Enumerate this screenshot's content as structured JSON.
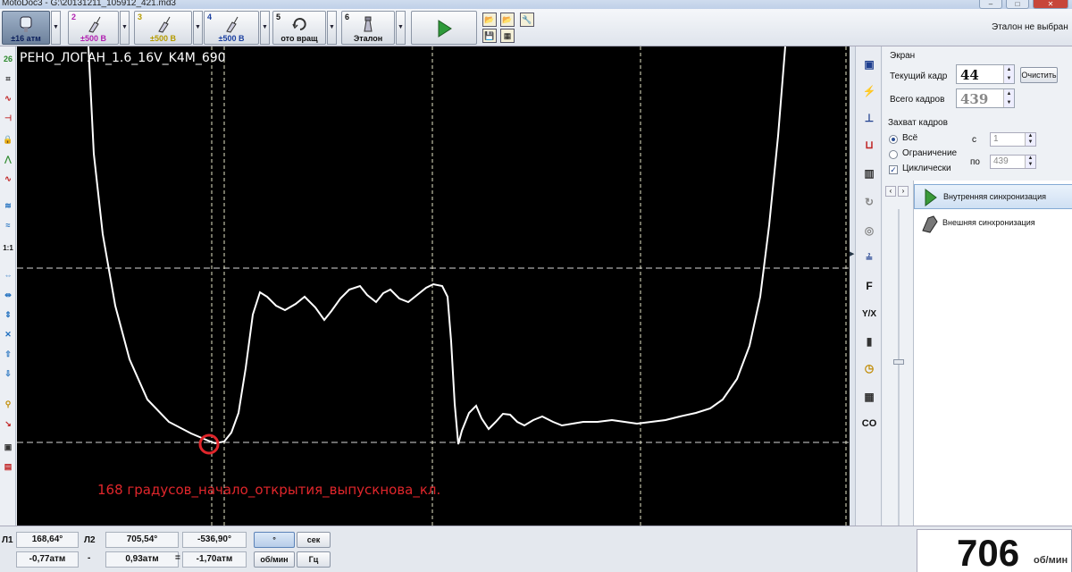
{
  "window": {
    "title": "MotoDoc3 - G:\\20131211_105912_421.md3",
    "close_label": "✕"
  },
  "toolbar": {
    "channels": [
      {
        "num": "",
        "label": "±16 атм",
        "color": "#1a3fa0"
      },
      {
        "num": "2",
        "label": "±500 В",
        "color": "#b020b0"
      },
      {
        "num": "3",
        "label": "±500 В",
        "color": "#b59b00"
      },
      {
        "num": "4",
        "label": "±500 В",
        "color": "#1a3fa0"
      },
      {
        "num": "5",
        "label": "ото вращ",
        "color": "#111111"
      },
      {
        "num": "6",
        "label": "Эталон",
        "color": "#111111"
      }
    ],
    "etalon_status": "Эталон не выбран"
  },
  "scope": {
    "title": "РЕНО_ЛОГАН_1.6_16V_K4M_690",
    "annotation": "168 градусов_начало_открытия_выпускнова_кл.",
    "trace_color": "#ffffff",
    "marker_color": "#e0262b"
  },
  "panel": {
    "screen_header": "Экран",
    "current_frame_label": "Текущий кадр",
    "current_frame_value": "44",
    "clear_button": "Очистить",
    "total_frames_label": "Всего кадров",
    "total_frames_value": "439",
    "capture_header": "Захват кадров",
    "opt_all": "Всё",
    "opt_limit": "Ограничение",
    "opt_cyclic": "Циклически",
    "from_label": "с",
    "from_value": "1",
    "to_label": "по",
    "to_value": "439",
    "sync_internal": "Внутренняя синхронизация",
    "sync_external": "Внешняя синхронизация"
  },
  "righttools": [
    "▣",
    "⚡",
    "⊥",
    "⊔",
    "▥",
    "↻",
    "◎",
    "≟",
    "F",
    "Y/X",
    "▮",
    "◷",
    "▦",
    "CO"
  ],
  "bottom": {
    "l1_label": "Л1",
    "l1_angle": "168,64°",
    "l2_label": "Л2",
    "l2_angle": "705,54°",
    "diff_angle": "-536,90°",
    "l1_press": "-0,77атм",
    "dash": "-",
    "l2_press": "0,93атм",
    "eq": "=",
    "diff_press": "-1,70атм",
    "deg_btn": "°",
    "sec_btn": "сек",
    "rpm_btn": "об/мин",
    "hz_btn": "Гц",
    "rpm_value": "706",
    "rpm_unit": "об/мин"
  }
}
